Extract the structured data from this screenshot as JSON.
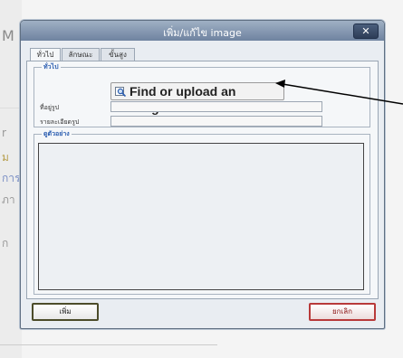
{
  "dialog": {
    "title": "เพิ่ม/แก้ไข image",
    "close_icon": "close-icon",
    "tabs": [
      {
        "label": "ทั่วไป",
        "active": true
      },
      {
        "label": "ลักษณะ",
        "active": false
      },
      {
        "label": "ขั้นสูง",
        "active": false
      }
    ],
    "general_legend": "ทั่วไป",
    "find_button": {
      "label": "Find or upload an image...",
      "icon": "image-search-icon"
    },
    "fields": [
      {
        "label": "ที่อยู่รูป",
        "value": ""
      },
      {
        "label": "รายละเอียดรูป",
        "value": ""
      }
    ],
    "preview_legend": "ดูตัวอย่าง",
    "insert_button": "เพิ่ม",
    "cancel_button": "ยกเลิก"
  },
  "background": {
    "fragments": [
      "M",
      "r",
      "ม",
      "การ",
      "ภา",
      "ก"
    ]
  },
  "colors": {
    "titlebar": "#7d8fa8",
    "legend_text": "#2a5db0",
    "cancel_border": "#b83a3a",
    "annotation_arrow": "#000000"
  }
}
